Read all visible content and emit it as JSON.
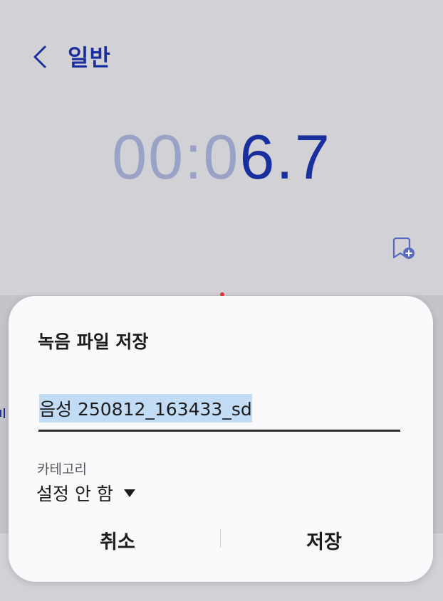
{
  "header": {
    "title": "일반",
    "back_icon": "chevron-left-icon"
  },
  "timer": {
    "dim_part": "00:0",
    "bright_part": "6.7"
  },
  "toolbar": {
    "bookmark_icon": "bookmark-add-icon"
  },
  "dialog": {
    "title": "녹음 파일 저장",
    "filename_value": "음성 250812_163433_sd",
    "category_label": "카테고리",
    "category_value": "설정 안 함",
    "category_arrow_icon": "triangle-down-icon",
    "cancel_label": "취소",
    "save_label": "저장"
  },
  "colors": {
    "accent": "#1a2f9e",
    "dim_accent": "#9aa2c6",
    "selection": "#c3dcf5",
    "background": "#d1d1d6",
    "dialog_bg": "#fafafc"
  }
}
